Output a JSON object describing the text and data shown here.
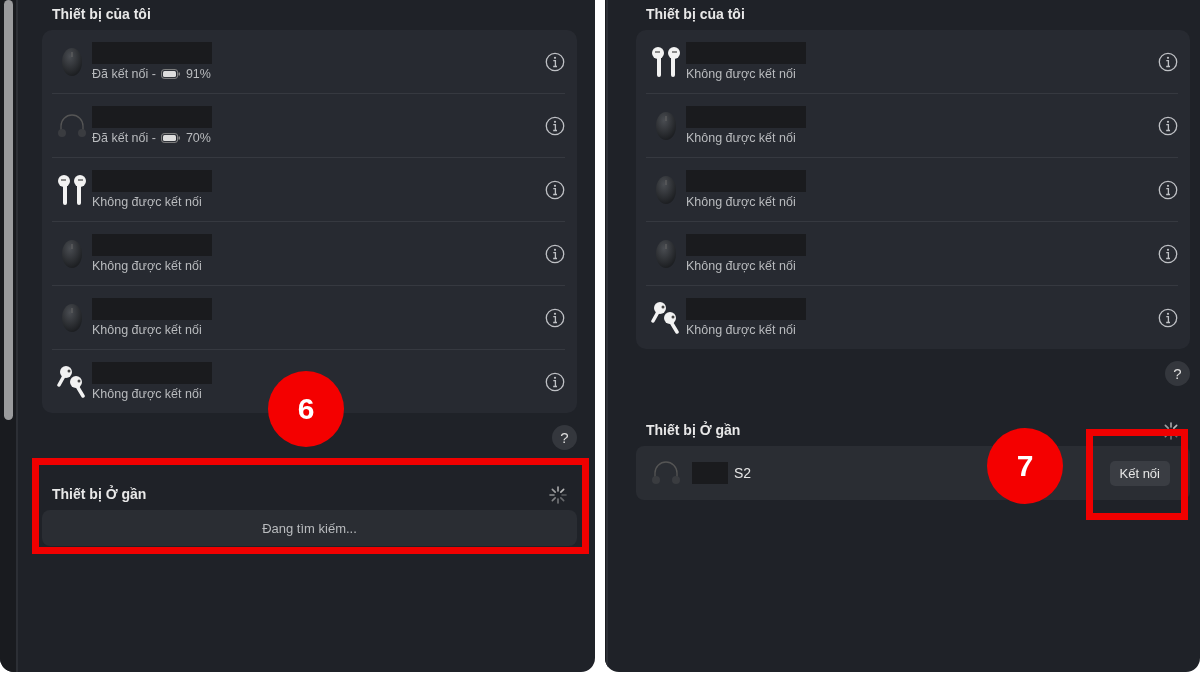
{
  "panels": [
    {
      "scrollbar": true,
      "my_devices": {
        "title": "Thiết bị của tôi",
        "devices": [
          {
            "kind": "mouse",
            "redacted": true,
            "status": "Đã kết nối -",
            "battery": "91%"
          },
          {
            "kind": "headphones",
            "redacted": true,
            "status": "Đã kết nối -",
            "battery": "70%"
          },
          {
            "kind": "airpods",
            "redacted": true,
            "status": "Không được kết nối"
          },
          {
            "kind": "mouse",
            "redacted": true,
            "status": "Không được kết nối"
          },
          {
            "kind": "mouse",
            "redacted": true,
            "status": "Không được kết nối"
          },
          {
            "kind": "airpods-pro",
            "redacted": true,
            "status": "Không được kết nối"
          }
        ]
      },
      "help": "?",
      "nearby": {
        "title": "Thiết bị Ở gần",
        "searching": "Đang tìm kiếm...",
        "highlighted": true
      },
      "annotation": {
        "number": "6"
      }
    },
    {
      "scrollbar": false,
      "my_devices": {
        "title": "Thiết bị của tôi",
        "devices": [
          {
            "kind": "airpods",
            "redacted": true,
            "status": "Không được kết nối"
          },
          {
            "kind": "mouse",
            "redacted": true,
            "status": "Không được kết nối"
          },
          {
            "kind": "mouse",
            "redacted": true,
            "status": "Không được kết nối"
          },
          {
            "kind": "mouse",
            "redacted": true,
            "status": "Không được kết nối"
          },
          {
            "kind": "airpods-pro",
            "redacted": true,
            "status": "Không được kết nối"
          }
        ]
      },
      "help": "?",
      "nearby": {
        "title": "Thiết bị Ở gần",
        "devices": [
          {
            "kind": "headphones",
            "redacted": true,
            "name": "S2",
            "action": "Kết nối",
            "action_highlighted": true
          }
        ]
      },
      "annotation": {
        "number": "7"
      }
    }
  ]
}
